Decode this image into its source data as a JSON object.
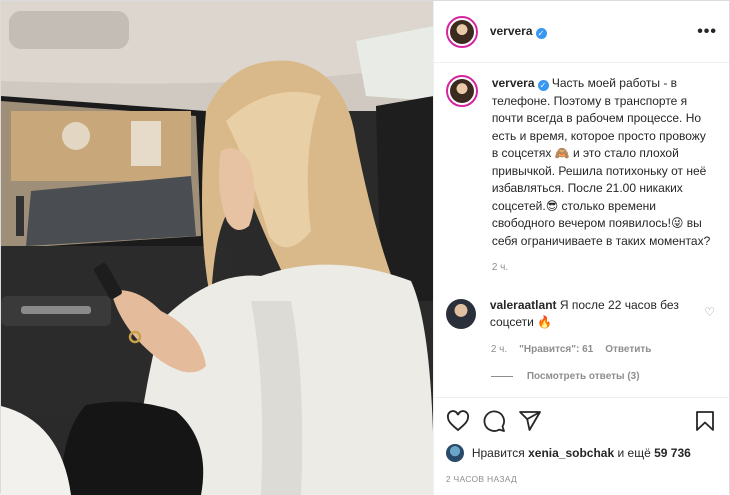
{
  "header": {
    "username": "ververa",
    "more_label": "•••"
  },
  "caption": {
    "username": "ververa",
    "text": "Часть моей работы - в телефоне. Поэтому в транспорте я почти всегда в рабочем процессе. Но есть и время, которое просто провожу в соцсетях 🙈 и это стало плохой привычкой. Решила потихоньку от неё избавляться. После 21.00 никаких соцсетей.😎 столько времени свободного вечером появилось!😜 вы себя ограничиваете в таких моментах?",
    "age": "2 ч."
  },
  "comment": {
    "username": "valeraatlant",
    "text": "Я после 22 часов без соцсети 🔥",
    "age": "2 ч.",
    "likes": "\"Нравится\": 61",
    "reply_label": "Ответить",
    "view_replies": "Посмотреть ответы (3)"
  },
  "likes": {
    "prefix": "Нравится",
    "liker": "xenia_sobchak",
    "suffix": "и ещё",
    "count": "59 736"
  },
  "timestamp": "2 ЧАСОВ НАЗАД",
  "colors": {
    "verified": "#3897f0",
    "muted": "#8e8e8e",
    "text": "#262626"
  },
  "icons": [
    "heart-icon",
    "comment-icon",
    "share-icon",
    "bookmark-icon"
  ]
}
